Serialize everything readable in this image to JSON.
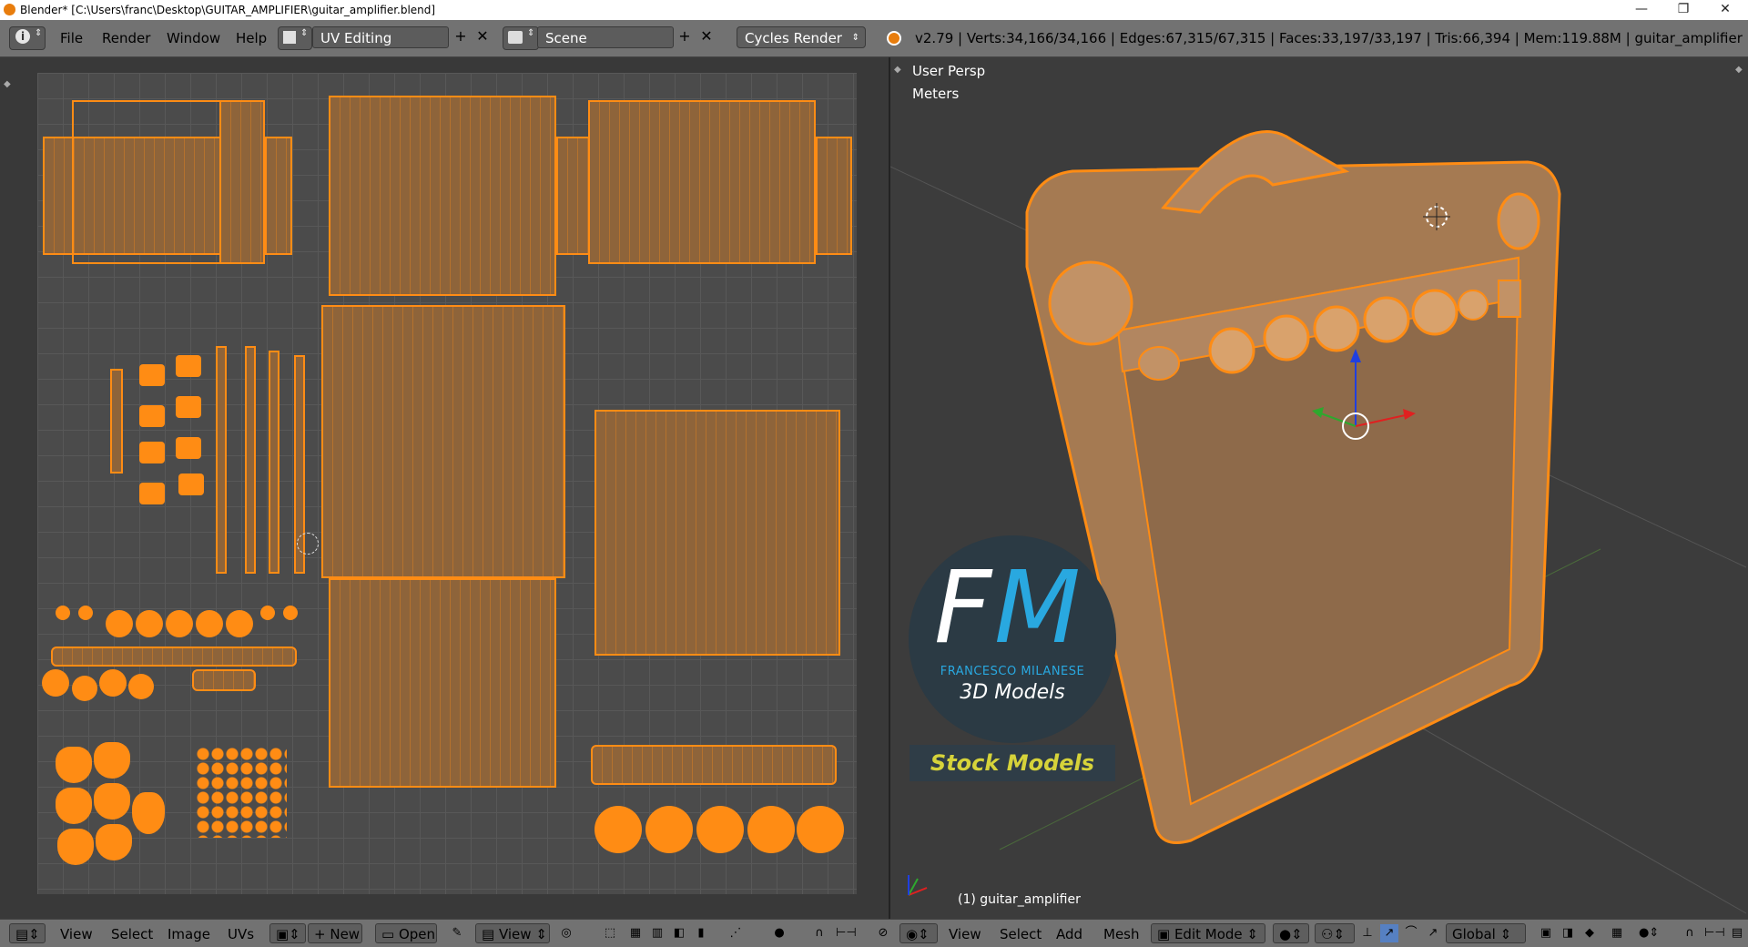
{
  "window": {
    "title": "Blender* [C:\\Users\\franc\\Desktop\\GUITAR_AMPLIFIER\\guitar_amplifier.blend]",
    "controls": [
      "—",
      "❐",
      "✕"
    ]
  },
  "menubar": {
    "info_icon": "info-icon",
    "menus": [
      "File",
      "Render",
      "Window",
      "Help"
    ],
    "screen_layout": "UV Editing",
    "scene": "Scene",
    "render_engine": "Cycles Render",
    "stats": "v2.79 | Verts:34,166/34,166 | Edges:67,315/67,315 | Faces:33,197/33,197 | Tris:66,394 | Mem:119.88M | guitar_amplifier"
  },
  "viewport": {
    "view_name": "User Persp",
    "units": "Meters",
    "object_label": "(1) guitar_amplifier"
  },
  "watermark": {
    "initials_f": "F",
    "initials_m": "M",
    "author": "FRANCESCO MILANESE",
    "tagline": "3D Models",
    "banner": "Stock Models"
  },
  "uv_toolbar": {
    "menus": [
      "View",
      "Select",
      "Image",
      "UVs"
    ],
    "new_label": "New",
    "open_label": "Open",
    "view_label": "View"
  },
  "view3d_toolbar": {
    "menus": [
      "View",
      "Select",
      "Add",
      "Mesh"
    ],
    "mode": "Edit Mode",
    "orientation": "Global"
  },
  "colors": {
    "selection_orange": "#ff8c14",
    "uv_fill": "#8e643a",
    "header_gray": "#727272",
    "viewport_bg": "#3c3c3c",
    "logo_blue": "#29a8e0",
    "banner_yellow": "#d6d33a"
  }
}
